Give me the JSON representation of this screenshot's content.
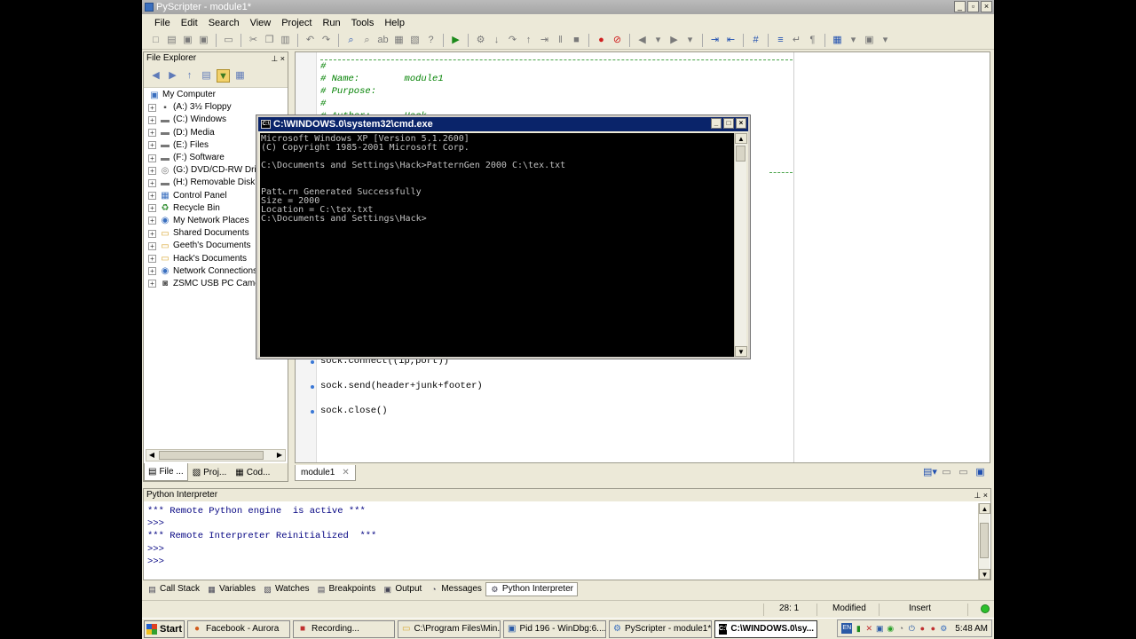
{
  "window": {
    "title": "PyScripter - module1*"
  },
  "menu": [
    "File",
    "Edit",
    "Search",
    "View",
    "Project",
    "Run",
    "Tools",
    "Help"
  ],
  "file_explorer": {
    "title": "File Explorer",
    "items": [
      {
        "label": "My Computer",
        "icon": "computer-icon",
        "expander": false
      },
      {
        "label": "(A:) 3½ Floppy",
        "icon": "floppy-icon",
        "expander": true
      },
      {
        "label": "(C:) Windows",
        "icon": "drive-icon",
        "expander": true
      },
      {
        "label": "(D:) Media",
        "icon": "drive-icon",
        "expander": true
      },
      {
        "label": "(E:) Files",
        "icon": "drive-icon",
        "expander": true
      },
      {
        "label": "(F:) Software",
        "icon": "drive-icon",
        "expander": true
      },
      {
        "label": "(G:) DVD/CD-RW Drive",
        "icon": "cd-icon",
        "expander": true
      },
      {
        "label": "(H:) Removable Disk",
        "icon": "drive-icon",
        "expander": true
      },
      {
        "label": "Control Panel",
        "icon": "control-panel-icon",
        "expander": true
      },
      {
        "label": "Recycle Bin",
        "icon": "recycle-bin-icon",
        "expander": true
      },
      {
        "label": "My Network Places",
        "icon": "network-icon",
        "expander": true
      },
      {
        "label": "Shared Documents",
        "icon": "folder-icon",
        "expander": true
      },
      {
        "label": "Geeth's Documents",
        "icon": "folder-icon",
        "expander": true
      },
      {
        "label": "Hack's Documents",
        "icon": "folder-icon",
        "expander": true
      },
      {
        "label": "Network Connections",
        "icon": "network-icon",
        "expander": true
      },
      {
        "label": "ZSMC USB PC Camera",
        "icon": "camera-icon",
        "expander": true
      }
    ],
    "tabs": [
      "File ...",
      "Proj...",
      "Cod..."
    ]
  },
  "editor": {
    "tab_label": "module1",
    "header_lines": [
      "#",
      "# Name:        module1",
      "# Purpose:",
      "#",
      "# Author:      Hack"
    ],
    "statements": [
      "sock.connect((ip,port))",
      "sock.send(header+junk+footer)",
      "sock.close()"
    ]
  },
  "cmd": {
    "title": "C:\\WINDOWS.0\\system32\\cmd.exe",
    "lines": [
      "Microsoft Windows XP [Version 5.1.2600]",
      "(C) Copyright 1985-2001 Microsoft Corp.",
      "",
      "C:\\Documents and Settings\\Hack>PatternGen 2000 C:\\tex.txt",
      "",
      "",
      "Pattern Generated Successfully",
      "Size = 2000",
      "Location = C:\\tex.txt",
      "C:\\Documents and Settings\\Hack>"
    ]
  },
  "interpreter": {
    "title": "Python Interpreter",
    "lines": [
      "*** Remote Python engine  is active ***",
      ">>>",
      "*** Remote Interpreter Reinitialized  ***",
      ">>>",
      ">>>"
    ]
  },
  "bottom_tabs": [
    "Call Stack",
    "Variables",
    "Watches",
    "Breakpoints",
    "Output",
    "Messages",
    "Python Interpreter"
  ],
  "status": {
    "position": "28: 1",
    "modified": "Modified",
    "mode": "Insert"
  },
  "taskbar": {
    "start": "Start",
    "tasks": [
      {
        "label": "Facebook - Aurora",
        "icon": "firefox-icon"
      },
      {
        "label": "Recording...",
        "icon": "recording-icon"
      },
      {
        "label": "C:\\Program Files\\Min...",
        "icon": "folder-icon"
      },
      {
        "label": "Pid 196 - WinDbg:6....",
        "icon": "windbg-icon"
      },
      {
        "label": "PyScripter - module1*",
        "icon": "pyscripter-icon"
      },
      {
        "label": "C:\\WINDOWS.0\\sy...",
        "icon": "cmd-icon"
      }
    ],
    "tray_lang": "EN",
    "clock": "5:48 AM"
  }
}
